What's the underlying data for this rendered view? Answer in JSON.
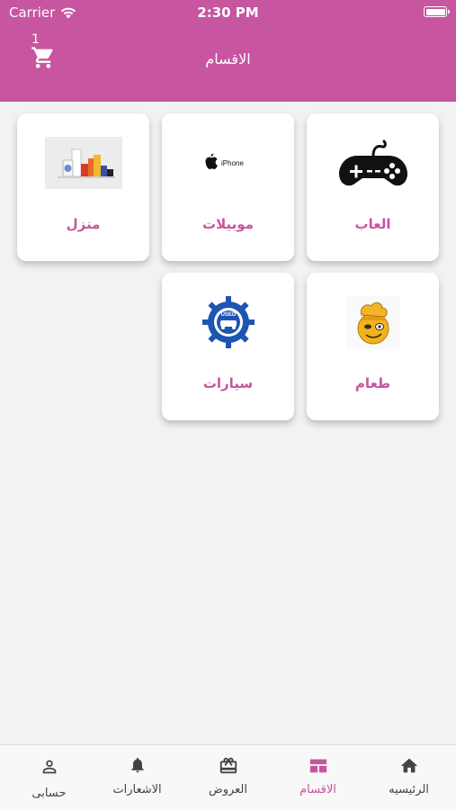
{
  "status_bar": {
    "carrier": "Carrier",
    "time": "2:30 PM"
  },
  "header": {
    "title": "الاقسام",
    "cart_count": "1",
    "background": "#c7559f"
  },
  "categories": [
    {
      "label": "العاب",
      "icon": "gamepad-icon"
    },
    {
      "label": "موبيلات",
      "icon": "iphone-logo-image"
    },
    {
      "label": "منزل",
      "icon": "home-appliances-image"
    },
    {
      "label": "طعام",
      "icon": "chef-emoji-image"
    },
    {
      "label": "سيارات",
      "icon": "used-gear-logo-image"
    }
  ],
  "tab_bar": {
    "items": [
      {
        "label": "الرئيسيه",
        "icon": "home-icon"
      },
      {
        "label": "الاقسام",
        "icon": "categories-icon",
        "active": true
      },
      {
        "label": "العروض",
        "icon": "gift-icon"
      },
      {
        "label": "الاشعارات",
        "icon": "bell-icon"
      },
      {
        "label": "حسابى",
        "icon": "user-icon"
      }
    ],
    "active_color": "#c7559f"
  }
}
